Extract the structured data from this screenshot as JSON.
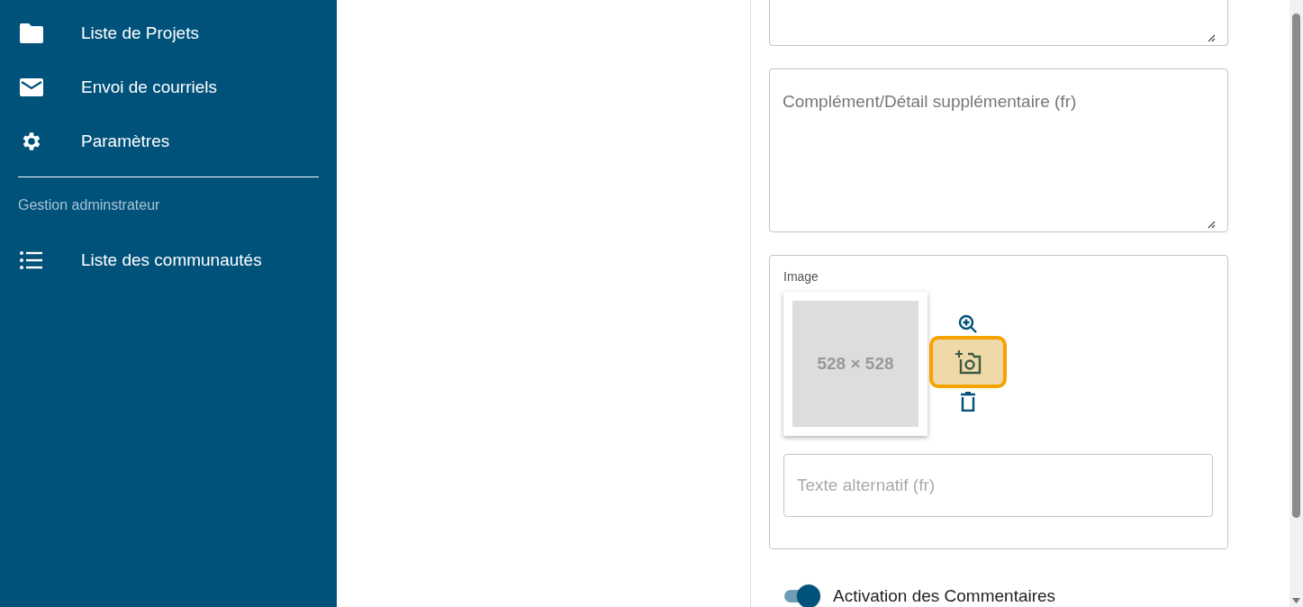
{
  "sidebar": {
    "items": [
      {
        "label": "Liste de Projets"
      },
      {
        "label": "Envoi de courriels"
      },
      {
        "label": "Paramètres"
      }
    ],
    "section_title": "Gestion adminstrateur",
    "admin_items": [
      {
        "label": "Liste des communautés"
      }
    ]
  },
  "form": {
    "detail_textarea": {
      "placeholder": "Complément/Détail supplémentaire (fr)"
    },
    "image": {
      "label": "Image",
      "preview_text": "528 × 528",
      "add_photo_focused": true,
      "alt_field": {
        "placeholder": "Texte alternatif (fr)"
      }
    },
    "comments_toggle": {
      "label": "Activation des Commentaires",
      "on": true
    }
  }
}
